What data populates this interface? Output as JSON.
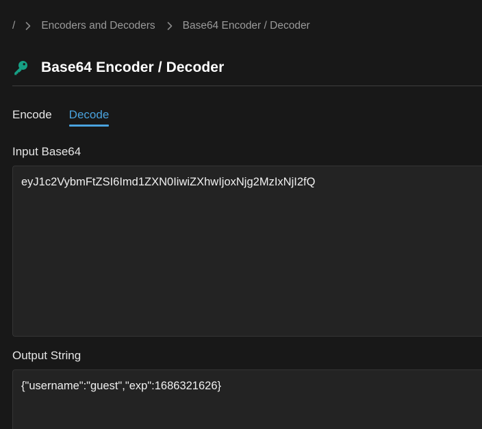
{
  "breadcrumb": {
    "root": "/",
    "items": [
      "Encoders and Decoders",
      "Base64 Encoder / Decoder"
    ]
  },
  "page": {
    "title": "Base64 Encoder / Decoder",
    "icon": "key-icon",
    "accent_color": "#16a085"
  },
  "tabs": [
    {
      "label": "Encode",
      "active": false
    },
    {
      "label": "Decode",
      "active": true
    }
  ],
  "input": {
    "label": "Input Base64",
    "value": "eyJ1c2VybmFtZSI6Imd1ZXN0IiwiZXhwIjoxNjg2MzIxNjI2fQ"
  },
  "output": {
    "label": "Output String",
    "value": "{\"username\":\"guest\",\"exp\":1686321626}"
  },
  "colors": {
    "background": "#181818",
    "tab_active": "#4aa3df",
    "text": "#e6e6e6"
  }
}
